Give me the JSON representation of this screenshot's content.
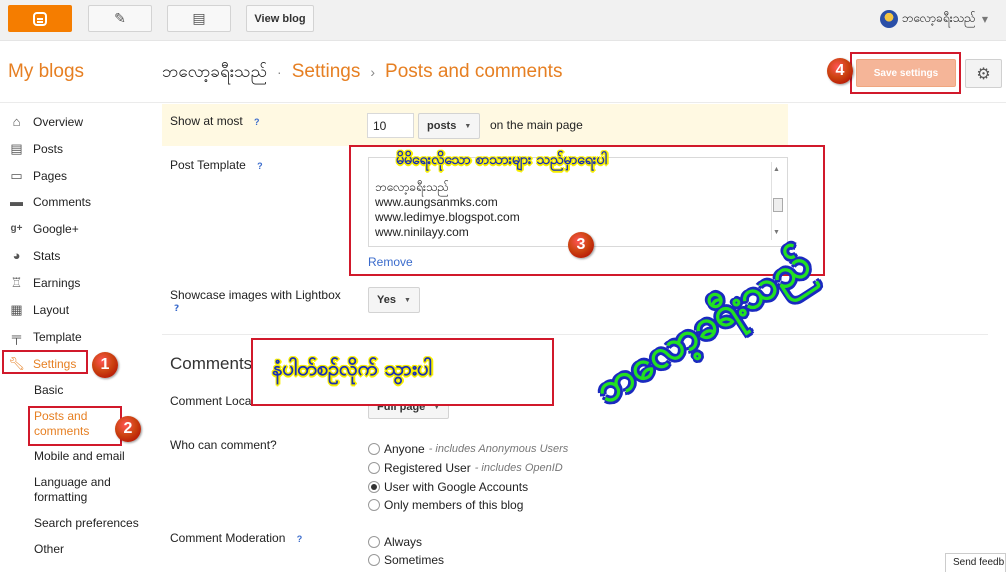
{
  "topbar": {
    "logo": "blogger-logo",
    "view_blog": "View blog",
    "user_name": "ဘလော့ခရီးသည်"
  },
  "header": {
    "my_blogs": "My blogs",
    "blog_name": "ဘလော့ခရီးသည်",
    "crumb_sep_1": "·",
    "crumb_settings": "Settings",
    "crumb_sep_2": "›",
    "crumb_page": "Posts and comments",
    "save_label": "Save settings"
  },
  "sidebar": {
    "items": [
      {
        "label": "Overview",
        "icon": "home-icon"
      },
      {
        "label": "Posts",
        "icon": "posts-icon"
      },
      {
        "label": "Pages",
        "icon": "pages-icon"
      },
      {
        "label": "Comments",
        "icon": "comment-icon"
      },
      {
        "label": "Google+",
        "icon": "googleplus-icon"
      },
      {
        "label": "Stats",
        "icon": "stats-icon"
      },
      {
        "label": "Earnings",
        "icon": "trophy-icon"
      },
      {
        "label": "Layout",
        "icon": "layout-icon"
      },
      {
        "label": "Template",
        "icon": "paint-roller-icon"
      },
      {
        "label": "Settings",
        "icon": "wrench-icon"
      }
    ],
    "sub_items": [
      "Basic",
      "Posts and comments",
      "Mobile and email",
      "Language and formatting",
      "Search preferences",
      "Other"
    ]
  },
  "posts": {
    "show_at_most_label": "Show at most",
    "show_at_most_value": "10",
    "show_unit": "posts",
    "show_suffix": "on the main page",
    "post_template_label": "Post Template",
    "template_lines": [
      "ဘလော့ခရီးသည်",
      "www.aungsanmks.com",
      "www.ledimye.blogspot.com",
      "www.ninilayy.com"
    ],
    "remove": "Remove",
    "lightbox_label": "Showcase images with Lightbox",
    "lightbox_value": "Yes",
    "help": "?"
  },
  "comments": {
    "title": "Comments",
    "location_label": "Comment Location",
    "location_value": "Full page",
    "who_label": "Who can comment?",
    "who_options": [
      {
        "label": "Anyone",
        "note": "- includes Anonymous Users",
        "checked": false
      },
      {
        "label": "Registered User",
        "note": "- includes OpenID",
        "checked": false
      },
      {
        "label": "User with Google Accounts",
        "note": "",
        "checked": true
      },
      {
        "label": "Only members of this blog",
        "note": "",
        "checked": false
      }
    ],
    "moderation_label": "Comment Moderation",
    "moderation_options": [
      {
        "label": "Always",
        "checked": false
      },
      {
        "label": "Sometimes",
        "checked": false
      }
    ]
  },
  "annotations": {
    "badges": [
      "1",
      "2",
      "3",
      "4"
    ],
    "caption_template": "မိမိရေးလိုသော စာသားများ သည်မှာရေးပါ",
    "caption_click": "နံပါတ်စဉ်လိုက် သွားပါ",
    "watermark": "ဘလော့ခရီးသည်"
  },
  "feedback": "Send feedb",
  "colors": {
    "accent": "#e67f22",
    "link": "#3a6bcc",
    "annotation_red": "#d1192b",
    "save_disabled": "#f5b598"
  }
}
